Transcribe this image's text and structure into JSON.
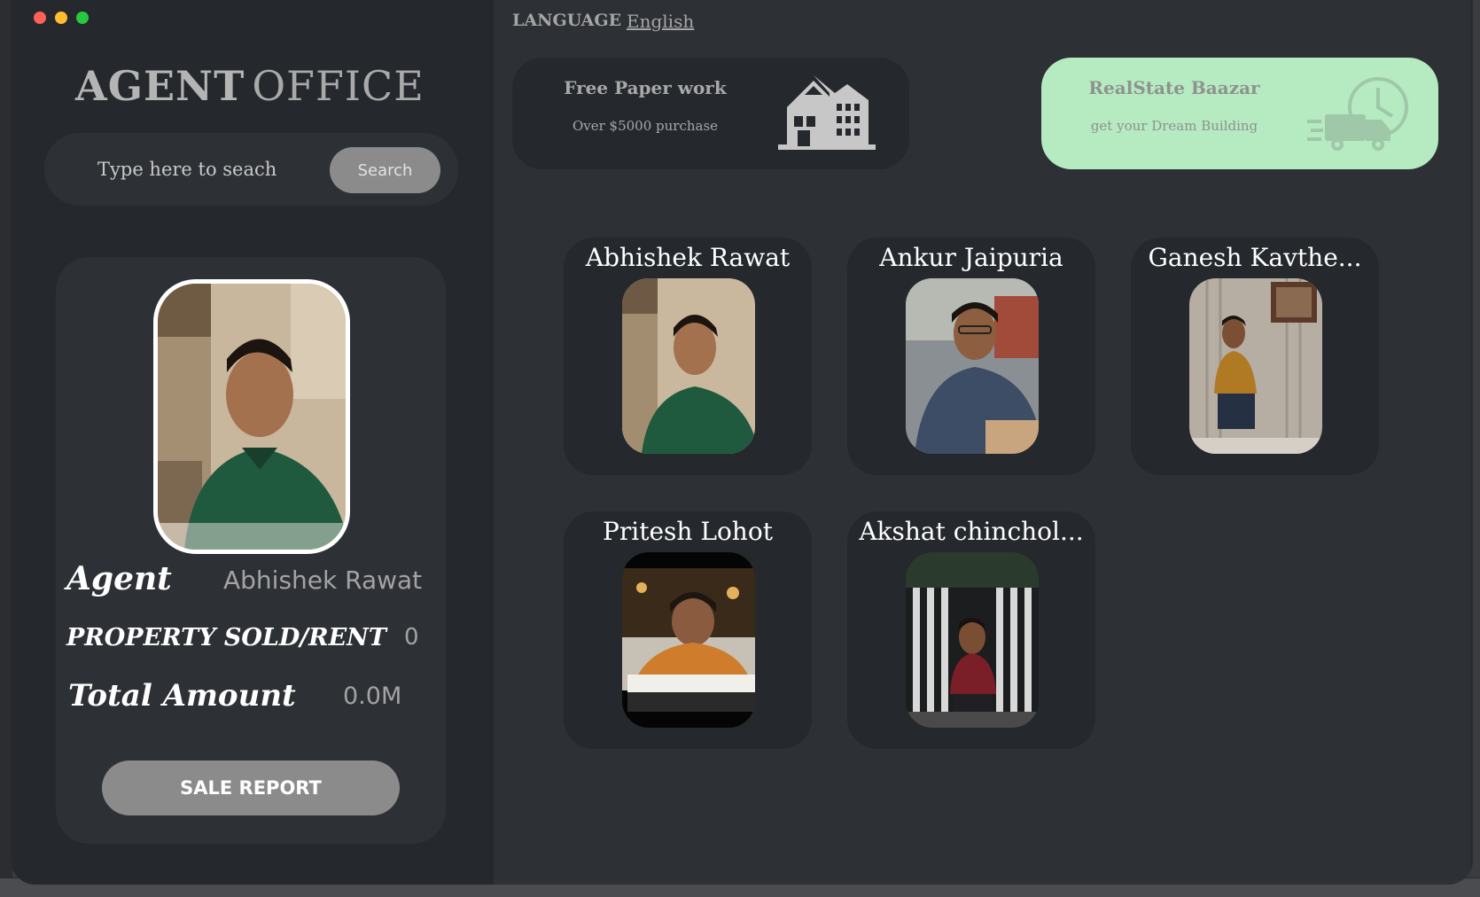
{
  "app": {
    "title_part1": "AGENT",
    "title_part2": "OFFICE"
  },
  "search": {
    "placeholder": "Type here to seach",
    "button_label": "Search"
  },
  "profile": {
    "agent_label": "Agent",
    "agent_name": "Abhishek Rawat",
    "sold_label": "PROPERTY SOLD/RENT",
    "sold_value": "0",
    "total_label": "Total Amount",
    "total_value": "0.0M",
    "report_button": "SALE REPORT"
  },
  "language": {
    "label": "LANGUAGE",
    "value": "English"
  },
  "promos": [
    {
      "title": "Free Paper work",
      "subtitle": "Over $5000 purchase",
      "icon": "house-icon",
      "bg": "#25282c"
    },
    {
      "title": "RealState Baazar",
      "subtitle": "get your Dream Building",
      "icon": "delivery-truck-clock-icon",
      "bg": "#b6eac1"
    }
  ],
  "agents": [
    {
      "name": "Abhishek Rawat"
    },
    {
      "name": "Ankur Jaipuria"
    },
    {
      "name": "Ganesh Kavthe..."
    },
    {
      "name": "Pritesh Lohot"
    },
    {
      "name": "Akshat chinchol..."
    }
  ],
  "colors": {
    "sidebar_bg": "#25282c",
    "main_bg": "#2d3035",
    "button_gray": "#8b8b8b",
    "promo_green": "#b6eac1"
  }
}
